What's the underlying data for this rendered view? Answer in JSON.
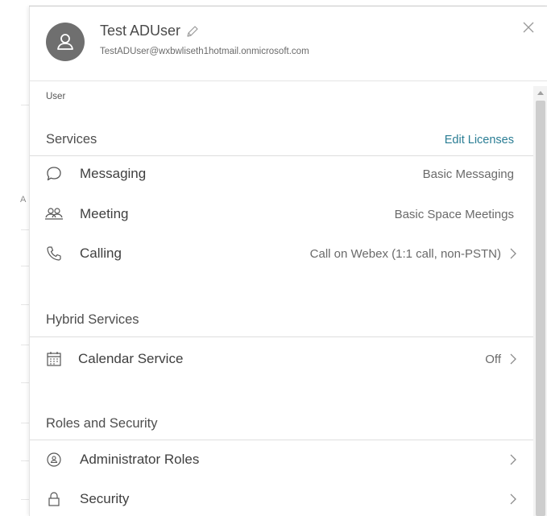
{
  "user": {
    "name": "Test ADUser",
    "email": "TestADUser@wxbwliseth1hotmail.onmicrosoft.com",
    "role": "User"
  },
  "background": {
    "letter": "A"
  },
  "services": {
    "title": "Services",
    "edit_label": "Edit Licenses",
    "items": [
      {
        "label": "Messaging",
        "value": "Basic Messaging",
        "icon": "chat-bubble-icon"
      },
      {
        "label": "Meeting",
        "value": "Basic Space Meetings",
        "icon": "meeting-people-icon"
      },
      {
        "label": "Calling",
        "value": "Call on Webex (1:1 call, non-PSTN)",
        "icon": "phone-icon"
      }
    ]
  },
  "hybrid": {
    "title": "Hybrid Services",
    "items": [
      {
        "label": "Calendar Service",
        "value": "Off",
        "icon": "calendar-icon"
      }
    ]
  },
  "roles": {
    "title": "Roles and Security",
    "items": [
      {
        "label": "Administrator Roles",
        "icon": "admin-badge-icon"
      },
      {
        "label": "Security",
        "icon": "lock-icon"
      }
    ]
  },
  "colors": {
    "link": "#2a7d94",
    "avatar": "#6f6f6f"
  }
}
